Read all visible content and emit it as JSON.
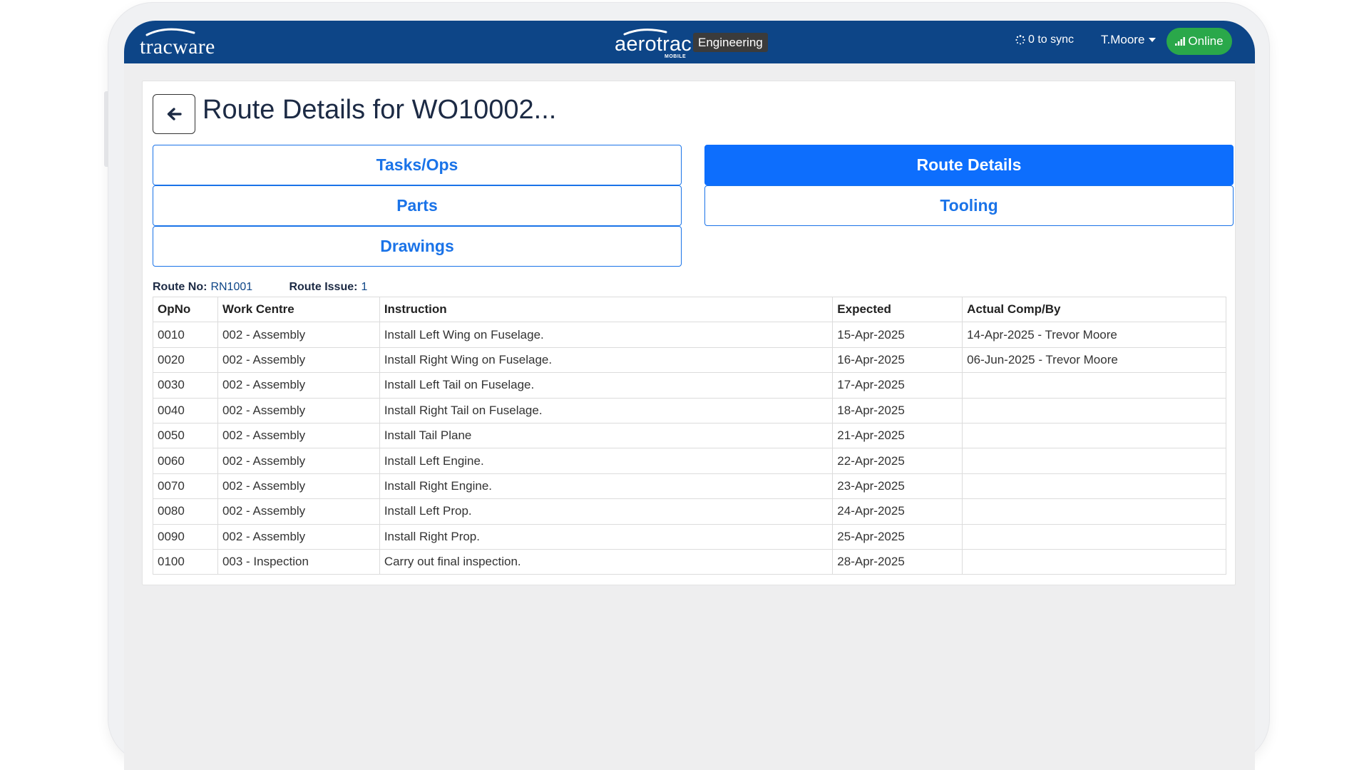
{
  "header": {
    "left_logo": "tracware",
    "center_logo": "aerotrac",
    "center_logo_sub": "MOBILE",
    "module_badge": "Engineering",
    "sync_text": "0 to sync",
    "user": "T.Moore",
    "status": "Online",
    "status_color": "#2aa84a",
    "bar_color": "#0d4587"
  },
  "page": {
    "title": "Route Details for WO10002...",
    "back_icon": "arrow-left-icon"
  },
  "tabs": [
    {
      "label": "Tasks/Ops",
      "active": false
    },
    {
      "label": "Route Details",
      "active": true
    },
    {
      "label": "Parts",
      "active": false
    },
    {
      "label": "Tooling",
      "active": false
    },
    {
      "label": "Drawings",
      "active": false
    }
  ],
  "route": {
    "no_label": "Route No:",
    "no_value": "RN1001",
    "issue_label": "Route Issue:",
    "issue_value": "1"
  },
  "table": {
    "headers": [
      "OpNo",
      "Work Centre",
      "Instruction",
      "Expected",
      "Actual Comp/By"
    ],
    "rows": [
      [
        "0010",
        "002 - Assembly",
        "Install Left Wing on Fuselage.",
        "15-Apr-2025",
        "14-Apr-2025 - Trevor Moore"
      ],
      [
        "0020",
        "002 - Assembly",
        "Install Right Wing on Fuselage.",
        "16-Apr-2025",
        "06-Jun-2025 - Trevor Moore"
      ],
      [
        "0030",
        "002 - Assembly",
        "Install Left Tail on Fuselage.",
        "17-Apr-2025",
        ""
      ],
      [
        "0040",
        "002 - Assembly",
        "Install Right Tail on Fuselage.",
        "18-Apr-2025",
        ""
      ],
      [
        "0050",
        "002 - Assembly",
        "Install Tail Plane",
        "21-Apr-2025",
        ""
      ],
      [
        "0060",
        "002 - Assembly",
        "Install Left Engine.",
        "22-Apr-2025",
        ""
      ],
      [
        "0070",
        "002 - Assembly",
        "Install Right Engine.",
        "23-Apr-2025",
        ""
      ],
      [
        "0080",
        "002 - Assembly",
        "Install Left Prop.",
        "24-Apr-2025",
        ""
      ],
      [
        "0090",
        "002 - Assembly",
        "Install Right Prop.",
        "25-Apr-2025",
        ""
      ],
      [
        "0100",
        "003 - Inspection",
        "Carry out final inspection.",
        "28-Apr-2025",
        ""
      ]
    ]
  }
}
